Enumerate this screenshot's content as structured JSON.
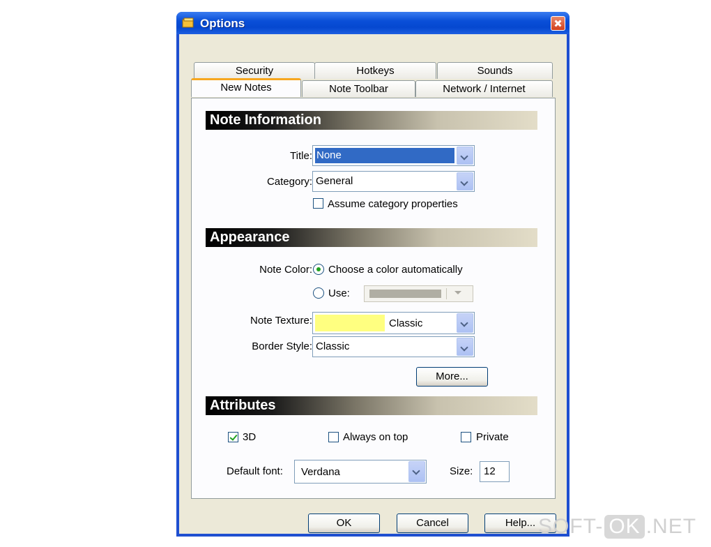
{
  "window": {
    "title": "Options",
    "app_icon": "folder-notes-icon"
  },
  "tabs_row1": [
    "Security",
    "Hotkeys",
    "Sounds"
  ],
  "tabs_row2": [
    "New Notes",
    "Note Toolbar",
    "Network / Internet"
  ],
  "active_tab": "New Notes",
  "note_information": {
    "header": "Note Information",
    "title_label": "Title:",
    "title_value": "None",
    "category_label": "Category:",
    "category_value": "General",
    "assume_label": "Assume category properties",
    "assume_checked": false
  },
  "appearance": {
    "header": "Appearance",
    "note_color_label": "Note Color:",
    "auto_color_label": "Choose a color automatically",
    "use_label": "Use:",
    "use_color": "#b0aea3",
    "texture_label": "Note Texture:",
    "texture_swatch": "#ffff80",
    "texture_value": "Classic",
    "border_label": "Border Style:",
    "border_value": "Classic",
    "more_button": "More..."
  },
  "attributes": {
    "header": "Attributes",
    "three_d_label": "3D",
    "three_d_checked": true,
    "always_on_top_label": "Always on top",
    "private_label": "Private",
    "default_font_label": "Default font:",
    "default_font_value": "Verdana",
    "size_label": "Size:",
    "size_value": "12"
  },
  "buttons": {
    "ok": "OK",
    "cancel": "Cancel",
    "help": "Help..."
  },
  "watermark": {
    "left": "SOFT-",
    "box": "OK",
    "right": ".NET"
  }
}
